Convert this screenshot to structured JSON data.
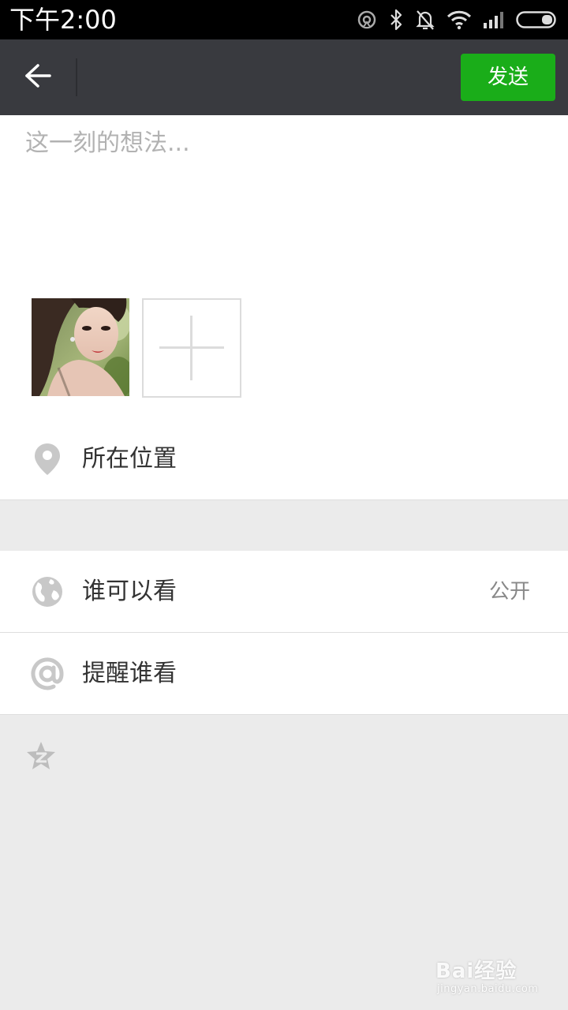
{
  "status_bar": {
    "time": "下午2:00",
    "icons": [
      "sync-icon",
      "bluetooth-icon",
      "silent-bell-icon",
      "wifi-icon",
      "signal-icon",
      "battery-icon"
    ]
  },
  "header": {
    "back_icon": "arrow-left-icon",
    "send_label": "发送"
  },
  "compose": {
    "placeholder": "这一刻的想法...",
    "value": "",
    "photos": [
      "selfie-photo"
    ],
    "add_photo_icon": "plus-icon"
  },
  "location": {
    "icon": "map-pin-icon",
    "label": "所在位置"
  },
  "visibility": {
    "icon": "globe-icon",
    "label": "谁可以看",
    "value": "公开"
  },
  "remind": {
    "icon": "at-icon",
    "label": "提醒谁看"
  },
  "share": {
    "icon": "qzone-star-icon"
  },
  "watermark": {
    "main": "Bai经验",
    "sub": "jingyan.baidu.com"
  },
  "colors": {
    "header_bg": "#393a3f",
    "send_button": "#1aad19",
    "page_bg": "#ebebeb"
  }
}
